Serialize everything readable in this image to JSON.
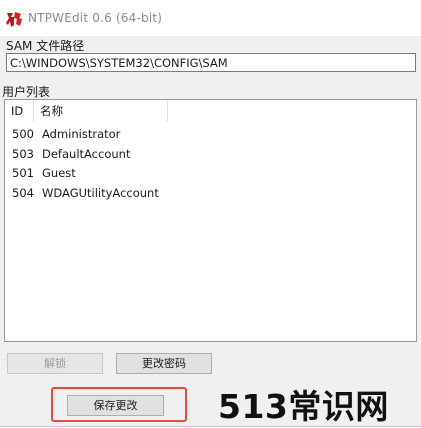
{
  "window": {
    "title": "NTPWEdit 0.6 (64-bit)",
    "icon": "ntpwedit-app-icon"
  },
  "sam": {
    "label": "SAM 文件路径",
    "path": "C:\\WINDOWS\\SYSTEM32\\CONFIG\\SAM"
  },
  "users": {
    "label": "用户列表",
    "columns": {
      "id": "ID",
      "name": "名称"
    },
    "rows": [
      {
        "id": "500",
        "name": "Administrator"
      },
      {
        "id": "503",
        "name": "DefaultAccount"
      },
      {
        "id": "501",
        "name": "Guest"
      },
      {
        "id": "504",
        "name": "WDAGUtilityAccount"
      }
    ]
  },
  "buttons": {
    "unlock": "解锁",
    "change_password": "更改密码",
    "save": "保存更改"
  },
  "colors": {
    "highlight": "#e24b3d",
    "disabled_text": "#9b9b9b"
  },
  "watermark": "513常识网"
}
